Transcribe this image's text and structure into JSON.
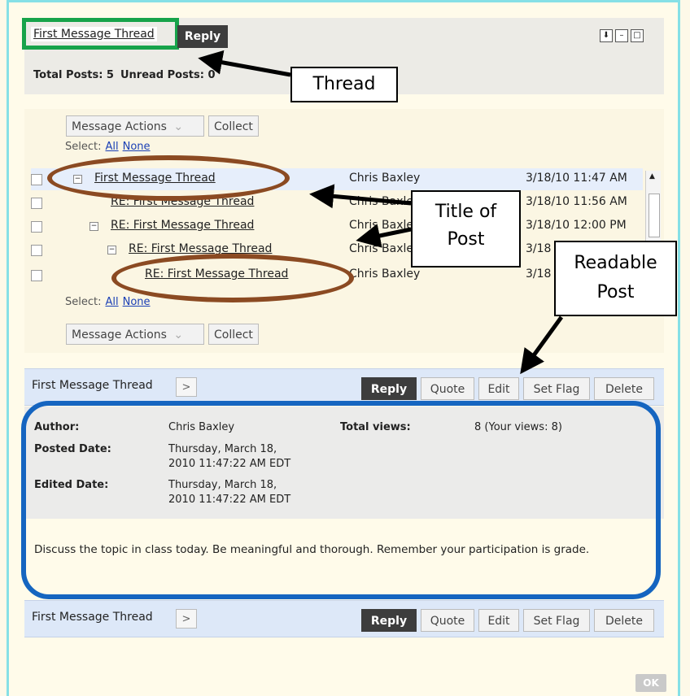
{
  "thread": {
    "title": "First Message Thread",
    "reply": "Reply",
    "total_posts": "Total Posts: 5",
    "unread_posts": "Unread Posts: 0"
  },
  "toolbar": {
    "message_actions": "Message Actions",
    "collect": "Collect",
    "select_label": "Select:",
    "all": "All",
    "none": "None"
  },
  "posts": [
    {
      "title": "First Message Thread",
      "author": "Chris Baxley",
      "date": "3/18/10 11:47 AM"
    },
    {
      "title": "RE: First Message Thread",
      "author": "Chris Baxley",
      "date": "3/18/10 11:56 AM"
    },
    {
      "title": "RE: First Message Thread",
      "author": "Chris Baxley",
      "date": "3/18/10 12:00 PM"
    },
    {
      "title": "RE: First Message Thread",
      "author": "Chris Baxley",
      "date": "3/18"
    },
    {
      "title": "RE: First Message Thread",
      "author": "Chris Baxley",
      "date": "3/18"
    }
  ],
  "post_bar": {
    "title": "First Message Thread",
    "next": ">",
    "reply": "Reply",
    "quote": "Quote",
    "edit": "Edit",
    "set_flag": "Set Flag",
    "delete": "Delete"
  },
  "detail": {
    "author_label": "Author:",
    "author": "Chris Baxley",
    "posted_label": "Posted Date:",
    "posted_1": "Thursday, March 18,",
    "posted_2": "2010 11:47:22 AM EDT",
    "edited_label": "Edited Date:",
    "edited_1": "Thursday, March 18,",
    "edited_2": "2010 11:47:22 AM EDT",
    "views_label": "Total views:",
    "views": "8 (Your views: 8)",
    "body": "Discuss the topic in class today. Be meaningful and thorough. Remember your participation is grade."
  },
  "ok": "OK",
  "callouts": {
    "thread": "Thread",
    "title_of_post_1": "Title of",
    "title_of_post_2": "Post",
    "readable_1": "Readable",
    "readable_2": "Post"
  },
  "colors": {
    "green_highlight": "#17a34a",
    "brown_ellipse": "#8b4a22",
    "blue_oval": "#1565c0",
    "frame_border": "#86e0e6"
  }
}
